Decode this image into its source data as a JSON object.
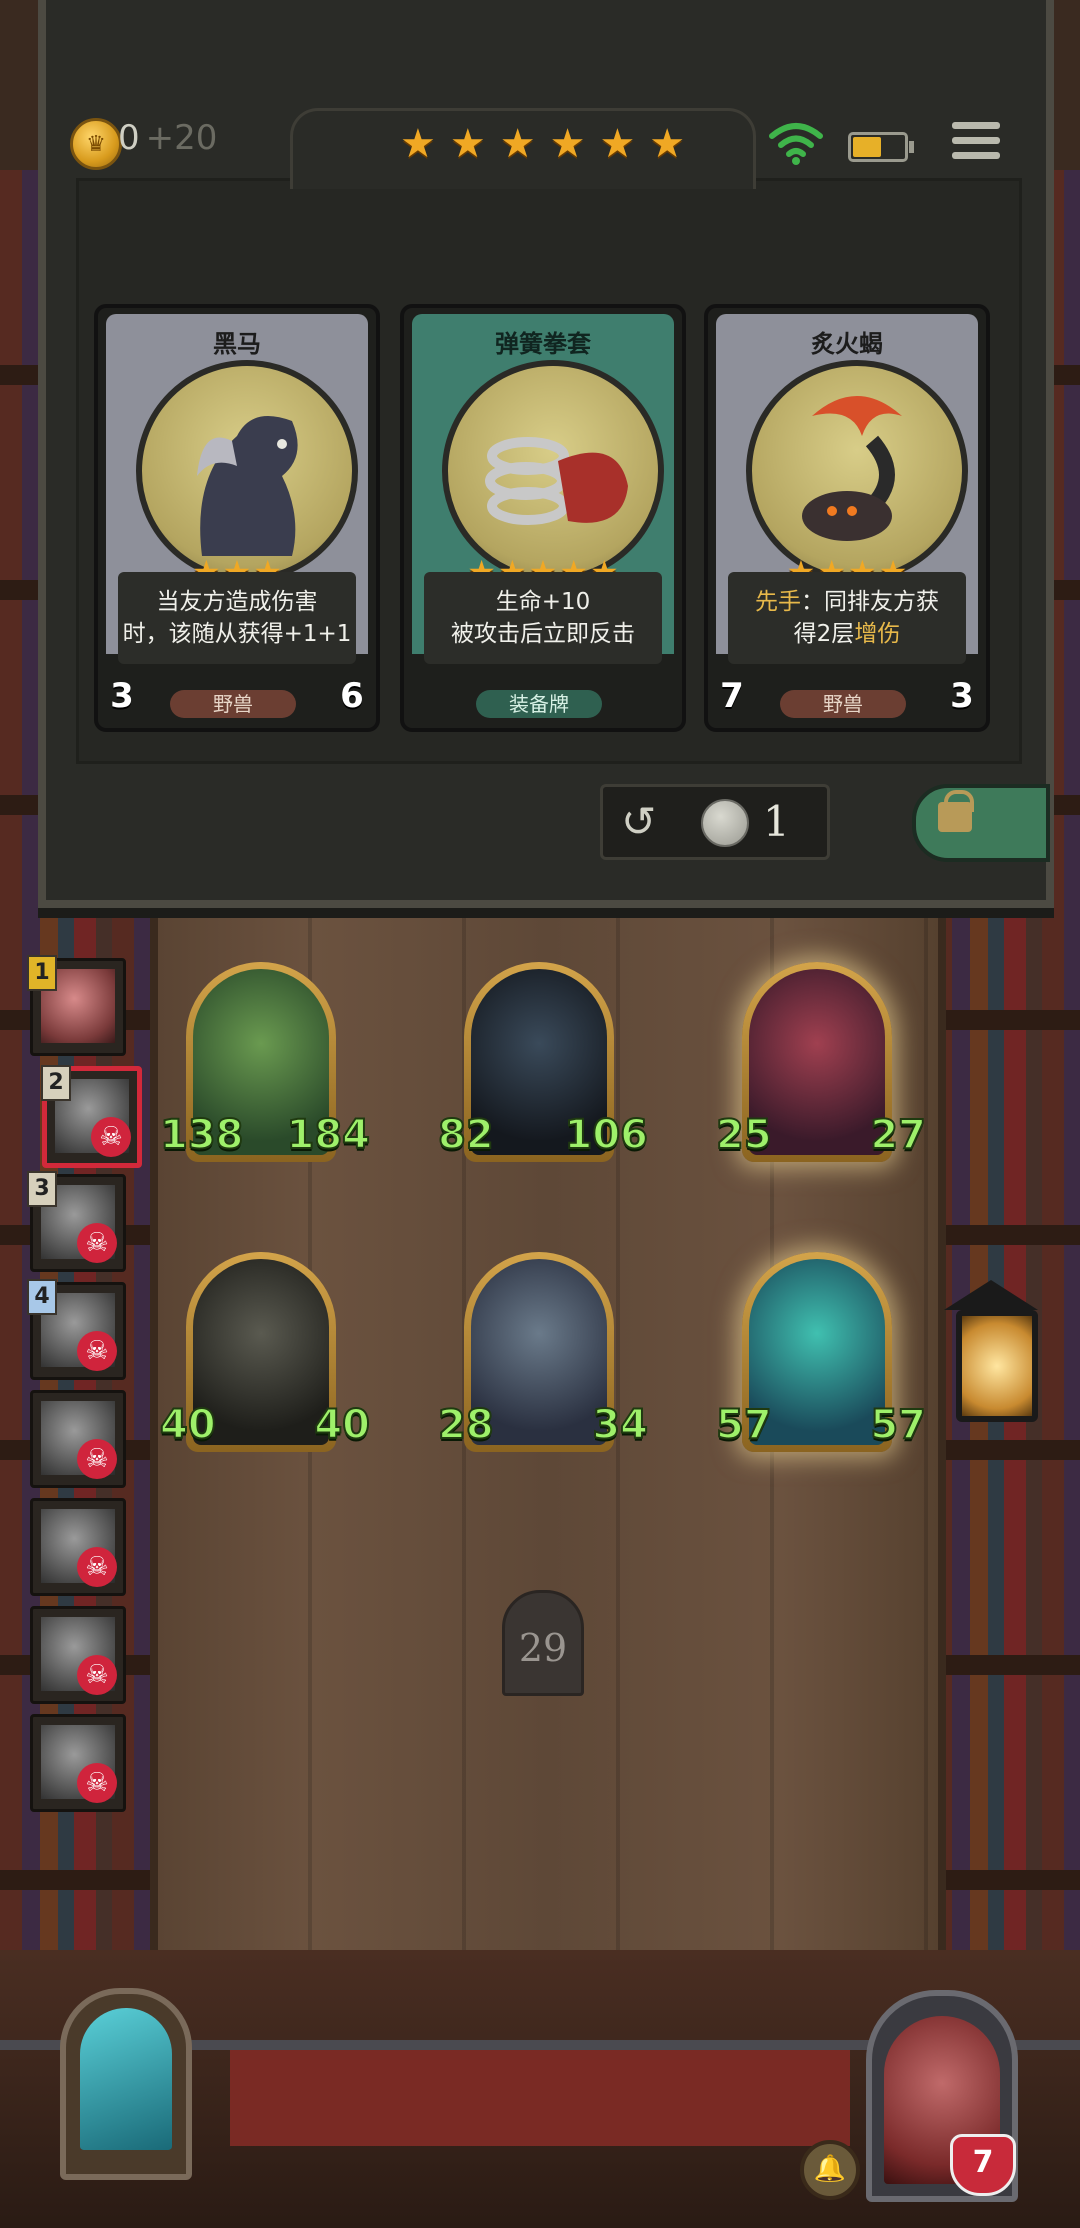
{
  "status": {
    "coins": "0",
    "income": "+20",
    "tier_stars": 6,
    "battery_level": 0.55
  },
  "icons": {
    "coin": "crown-coin-icon",
    "wifi": "wifi-icon",
    "battery": "battery-icon",
    "menu": "menu-icon",
    "refresh": "refresh-icon",
    "lock": "lock-icon",
    "skull": "skull-icon"
  },
  "shop": {
    "cards": [
      {
        "name": "黑马",
        "stars": 3,
        "desc_line1": "当友方造成伤害",
        "desc_line2": "时，该随从获得+1+1",
        "tag": "野兽",
        "attack": "3",
        "health": "6"
      },
      {
        "name": "弹簧拳套",
        "stars": 5,
        "desc_line1": "生命+10",
        "desc_line2": "被攻击后立即反击",
        "tag": "装备牌"
      },
      {
        "name": "炙火蝎",
        "stars": 4,
        "desc_kw": "先手",
        "desc_rest1": "：同排友方获",
        "desc_rest2": "得2层",
        "desc_kw2": "增伤",
        "tag": "野兽",
        "attack": "7",
        "health": "3"
      }
    ],
    "refresh_cost": "1"
  },
  "opponents": [
    {
      "num": "1"
    },
    {
      "num": "2"
    },
    {
      "num": "3"
    },
    {
      "num": "4"
    },
    {
      "num": ""
    },
    {
      "num": ""
    },
    {
      "num": ""
    },
    {
      "num": ""
    }
  ],
  "board": {
    "front": [
      {
        "attack": "138",
        "health": "184"
      },
      {
        "attack": "82",
        "health": "106"
      },
      {
        "attack": "25",
        "health": "27"
      }
    ],
    "back": [
      {
        "attack": "40",
        "health": "40"
      },
      {
        "attack": "28",
        "health": "34"
      },
      {
        "attack": "57",
        "health": "57"
      }
    ]
  },
  "turn": "29",
  "hero": {
    "health": "7"
  },
  "colors": {
    "star": "#f0a824",
    "stat_green": "#9ef06a",
    "eliminated": "#d0243c",
    "selected_border": "#d2293a",
    "keyword": "#e8b94a"
  }
}
